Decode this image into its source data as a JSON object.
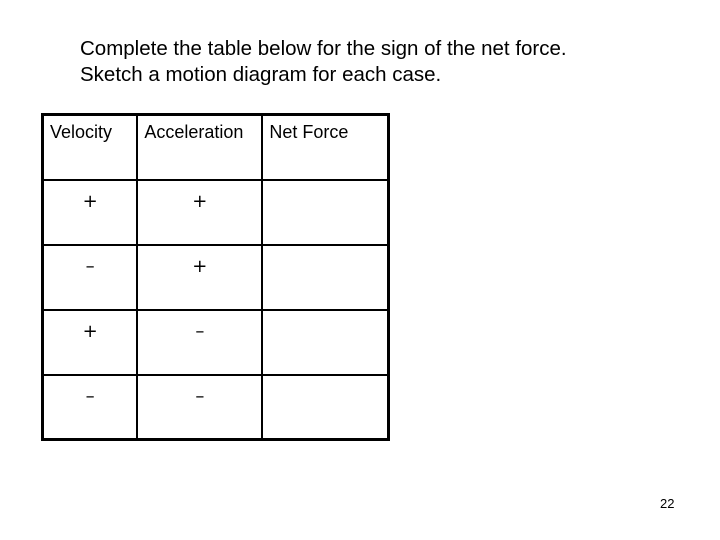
{
  "instructions": {
    "line1": "Complete the table below for the sign of the net force.",
    "line2": "Sketch a motion diagram for each case."
  },
  "table": {
    "headers": [
      "Velocity",
      "Acceleration",
      "Net Force"
    ],
    "rows": [
      {
        "velocity": "+",
        "acceleration": "+",
        "net_force": ""
      },
      {
        "velocity": "–",
        "acceleration": "+",
        "net_force": ""
      },
      {
        "velocity": "+",
        "acceleration": "–",
        "net_force": ""
      },
      {
        "velocity": "–",
        "acceleration": "–",
        "net_force": ""
      }
    ]
  },
  "page_number": "22"
}
